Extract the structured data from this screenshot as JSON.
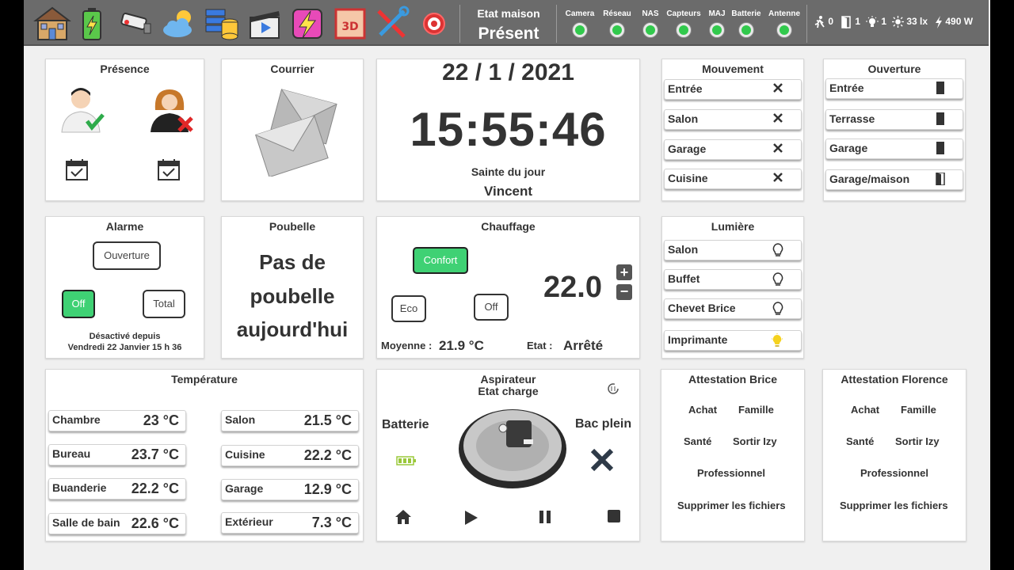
{
  "topbar": {
    "icons": [
      "house-icon",
      "battery-icon",
      "camera-icon",
      "weather-icon",
      "server-icon",
      "media-icon",
      "energy-icon",
      "printer-3d-icon",
      "tools-icon",
      "target-icon"
    ],
    "etat_label": "Etat maison",
    "etat_value": "Présent",
    "status": [
      {
        "label": "Camera",
        "color": "#31c94c"
      },
      {
        "label": "Réseau",
        "color": "#31c94c"
      },
      {
        "label": "NAS",
        "color": "#31c94c"
      },
      {
        "label": "Capteurs",
        "color": "#31c94c"
      },
      {
        "label": "MAJ",
        "color": "#31c94c"
      },
      {
        "label": "Batterie",
        "color": "#31c94c"
      },
      {
        "label": "Antenne",
        "color": "#31c94c"
      }
    ],
    "motion_count": "0",
    "door_count": "1",
    "light_count": "1",
    "lux": "33 lx",
    "power": "490 W"
  },
  "presence": {
    "title": "Présence"
  },
  "courrier": {
    "title": "Courrier"
  },
  "clock": {
    "date": "22 / 1 / 2021",
    "time": "15:55:46",
    "saint_label": "Sainte du jour",
    "saint_name": "Vincent"
  },
  "mouvement": {
    "title": "Mouvement",
    "rows": [
      "Entrée",
      "Salon",
      "Garage",
      "Cuisine"
    ]
  },
  "ouverture": {
    "title": "Ouverture",
    "rows": [
      "Entrée",
      "Terrasse",
      "Garage",
      "Garage/maison"
    ]
  },
  "alarme": {
    "title": "Alarme",
    "ouverture_label": "Ouverture",
    "off_label": "Off",
    "total_label": "Total",
    "status_line1": "Désactivé depuis",
    "status_line2": "Vendredi 22 Janvier 15 h 36"
  },
  "poubelle": {
    "title": "Poubelle",
    "line1": "Pas de",
    "line2": "poubelle",
    "line3": "aujourd'hui"
  },
  "chauffage": {
    "title": "Chauffage",
    "confort_label": "Confort",
    "eco_label": "Eco",
    "off_label": "Off",
    "setpoint": "22.0",
    "moyenne_label": "Moyenne :",
    "moyenne_value": "21.9 °C",
    "etat_label": "Etat :",
    "etat_value": "Arrêté"
  },
  "lumiere": {
    "title": "Lumière",
    "rows": [
      {
        "label": "Salon",
        "on": false
      },
      {
        "label": "Buffet",
        "on": false
      },
      {
        "label": "Chevet Brice",
        "on": false
      },
      {
        "label": "Imprimante",
        "on": true
      }
    ]
  },
  "temperature": {
    "title": "Température",
    "rooms": [
      {
        "name": "Chambre",
        "value": "23 °C"
      },
      {
        "name": "Bureau",
        "value": "23.7 °C"
      },
      {
        "name": "Buanderie",
        "value": "22.2 °C"
      },
      {
        "name": "Salle de bain",
        "value": "22.6 °C"
      },
      {
        "name": "Salon",
        "value": "21.5 °C"
      },
      {
        "name": "Cuisine",
        "value": "22.2 °C"
      },
      {
        "name": "Garage",
        "value": "12.9 °C"
      },
      {
        "name": "Extérieur",
        "value": "7.3 °C"
      }
    ]
  },
  "aspirateur": {
    "title": "Aspirateur",
    "etat": "Etat charge",
    "batterie_label": "Batterie",
    "bac_label": "Bac plein"
  },
  "att_brice": {
    "title": "Attestation Brice",
    "achat": "Achat",
    "famille": "Famille",
    "sante": "Santé",
    "sortir": "Sortir Izy",
    "pro": "Professionnel",
    "suppr": "Supprimer les fichiers"
  },
  "att_florence": {
    "title": "Attestation Florence",
    "achat": "Achat",
    "famille": "Famille",
    "sante": "Santé",
    "sortir": "Sortir Izy",
    "pro": "Professionnel",
    "suppr": "Supprimer les fichiers"
  }
}
